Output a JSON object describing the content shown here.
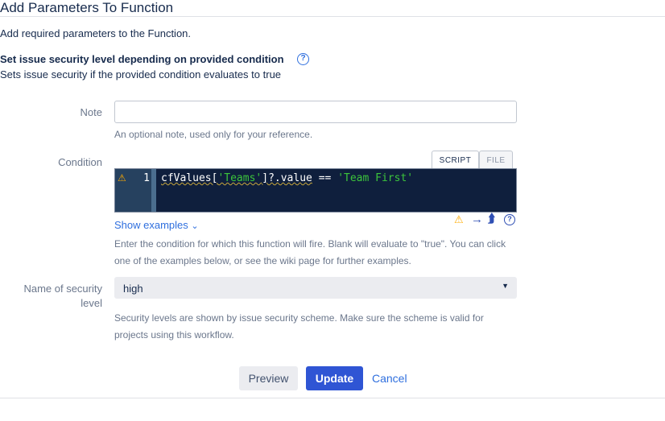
{
  "title": "Add Parameters To Function",
  "subtitle": "Add required parameters to the Function.",
  "function_name": "Set issue security level depending on provided condition",
  "function_desc": "Sets issue security if the provided condition evaluates to true",
  "note": {
    "label": "Note",
    "value": "",
    "help": "An optional note, used only for your reference."
  },
  "condition": {
    "label": "Condition",
    "tabs": [
      "SCRIPT",
      "FILE"
    ],
    "active_tab": "SCRIPT",
    "line_number": "1",
    "code": {
      "p1": "cfValues[",
      "s1": "'Teams'",
      "p2": "]?.value",
      "p3": " == ",
      "s2": "'Team First'"
    },
    "show_examples": "Show examples",
    "help": "Enter the condition for which this function will fire. Blank will evaluate to \"true\". You can click one of the examples below, or see the wiki page for further examples."
  },
  "security": {
    "label": "Name of security level",
    "value": "high",
    "help": "Security levels are shown by issue security scheme. Make sure the scheme is valid for projects using this workflow."
  },
  "buttons": {
    "preview": "Preview",
    "update": "Update",
    "cancel": "Cancel"
  }
}
